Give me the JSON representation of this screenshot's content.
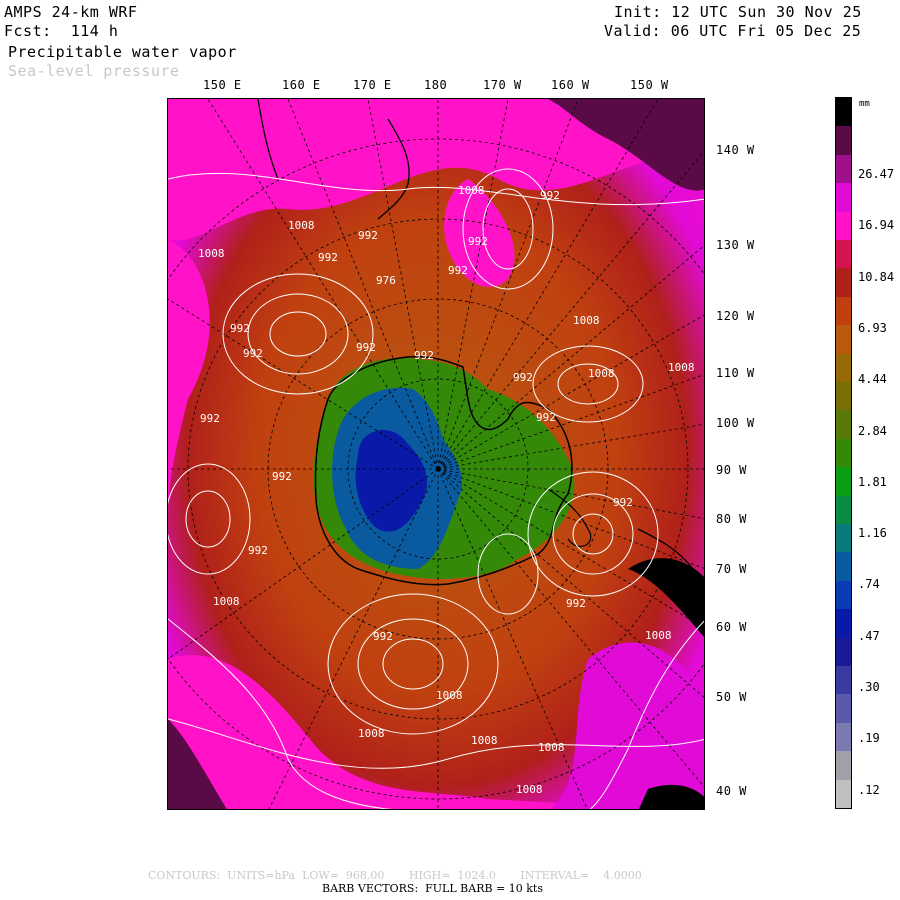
{
  "header": {
    "model": "AMPS 24-km WRF",
    "forecast": "Fcst:  114 h",
    "field": "Precipitable water vapor",
    "overlay": "Sea-level pressure",
    "init": "Init: 12 UTC Sun 30 Nov 25",
    "valid": "Valid: 06 UTC Fri 05 Dec 25"
  },
  "top_longitudes": [
    "150 E",
    "160 E",
    "170 E",
    "180",
    "170 W",
    "160 W",
    "150 W"
  ],
  "right_longitudes": [
    "140 W",
    "130 W",
    "120 W",
    "110 W",
    "100 W",
    "90 W",
    "80 W",
    "70 W",
    "60 W",
    "50 W",
    "40 W"
  ],
  "colorbar": {
    "units": "mm",
    "labels": [
      "26.47",
      "16.94",
      "10.84",
      "6.93",
      "4.44",
      "2.84",
      "1.81",
      "1.16",
      ".74",
      ".47",
      ".30",
      ".19",
      ".12"
    ],
    "colors": [
      "#000000",
      "#5a0a46",
      "#a0108c",
      "#e20ad6",
      "#ff12c8",
      "#d21450",
      "#b0201a",
      "#c04010",
      "#b85a10",
      "#966a08",
      "#7a6e08",
      "#5a7a08",
      "#348a08",
      "#0a9e14",
      "#0a8c46",
      "#0a7a7a",
      "#0a5aa0",
      "#0a3ab4",
      "#0a1aa8",
      "#1a1a96",
      "#3a3aa0",
      "#5a5aa8",
      "#7a7ab0",
      "#a0a0a8",
      "#c0c0c0"
    ]
  },
  "pressure_labels": [
    "1008",
    "1008",
    "1008",
    "1008",
    "1008",
    "992",
    "992",
    "992",
    "992",
    "992",
    "976",
    "992",
    "992",
    "992",
    "992",
    "992",
    "992",
    "992",
    "992",
    "992",
    "992",
    "992",
    "992",
    "1008",
    "1008",
    "1008",
    "1008",
    "1008",
    "1008",
    "1008",
    "1008"
  ],
  "footer": {
    "contours": "CONTOURS:  UNITS=hPa  LOW=  968.00       HIGH=  1024.0       INTERVAL=    4.0000",
    "barbs": "BARB VECTORS:  FULL BARB = 10 kts"
  }
}
